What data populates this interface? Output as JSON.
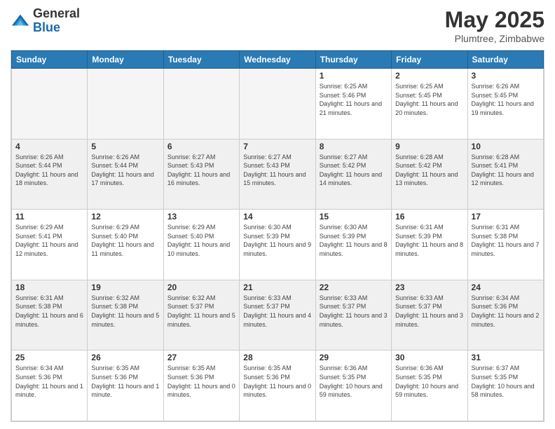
{
  "header": {
    "logo_general": "General",
    "logo_blue": "Blue",
    "title": "May 2025",
    "subtitle": "Plumtree, Zimbabwe"
  },
  "calendar": {
    "days_of_week": [
      "Sunday",
      "Monday",
      "Tuesday",
      "Wednesday",
      "Thursday",
      "Friday",
      "Saturday"
    ],
    "weeks": [
      [
        {
          "day": "",
          "empty": true
        },
        {
          "day": "",
          "empty": true
        },
        {
          "day": "",
          "empty": true
        },
        {
          "day": "",
          "empty": true
        },
        {
          "day": "1",
          "sunrise": "6:25 AM",
          "sunset": "5:46 PM",
          "daylight": "11 hours and 21 minutes."
        },
        {
          "day": "2",
          "sunrise": "6:25 AM",
          "sunset": "5:45 PM",
          "daylight": "11 hours and 20 minutes."
        },
        {
          "day": "3",
          "sunrise": "6:26 AM",
          "sunset": "5:45 PM",
          "daylight": "11 hours and 19 minutes."
        }
      ],
      [
        {
          "day": "4",
          "sunrise": "6:26 AM",
          "sunset": "5:44 PM",
          "daylight": "11 hours and 18 minutes."
        },
        {
          "day": "5",
          "sunrise": "6:26 AM",
          "sunset": "5:44 PM",
          "daylight": "11 hours and 17 minutes."
        },
        {
          "day": "6",
          "sunrise": "6:27 AM",
          "sunset": "5:43 PM",
          "daylight": "11 hours and 16 minutes."
        },
        {
          "day": "7",
          "sunrise": "6:27 AM",
          "sunset": "5:43 PM",
          "daylight": "11 hours and 15 minutes."
        },
        {
          "day": "8",
          "sunrise": "6:27 AM",
          "sunset": "5:42 PM",
          "daylight": "11 hours and 14 minutes."
        },
        {
          "day": "9",
          "sunrise": "6:28 AM",
          "sunset": "5:42 PM",
          "daylight": "11 hours and 13 minutes."
        },
        {
          "day": "10",
          "sunrise": "6:28 AM",
          "sunset": "5:41 PM",
          "daylight": "11 hours and 12 minutes."
        }
      ],
      [
        {
          "day": "11",
          "sunrise": "6:29 AM",
          "sunset": "5:41 PM",
          "daylight": "11 hours and 12 minutes."
        },
        {
          "day": "12",
          "sunrise": "6:29 AM",
          "sunset": "5:40 PM",
          "daylight": "11 hours and 11 minutes."
        },
        {
          "day": "13",
          "sunrise": "6:29 AM",
          "sunset": "5:40 PM",
          "daylight": "11 hours and 10 minutes."
        },
        {
          "day": "14",
          "sunrise": "6:30 AM",
          "sunset": "5:39 PM",
          "daylight": "11 hours and 9 minutes."
        },
        {
          "day": "15",
          "sunrise": "6:30 AM",
          "sunset": "5:39 PM",
          "daylight": "11 hours and 8 minutes."
        },
        {
          "day": "16",
          "sunrise": "6:31 AM",
          "sunset": "5:39 PM",
          "daylight": "11 hours and 8 minutes."
        },
        {
          "day": "17",
          "sunrise": "6:31 AM",
          "sunset": "5:38 PM",
          "daylight": "11 hours and 7 minutes."
        }
      ],
      [
        {
          "day": "18",
          "sunrise": "6:31 AM",
          "sunset": "5:38 PM",
          "daylight": "11 hours and 6 minutes."
        },
        {
          "day": "19",
          "sunrise": "6:32 AM",
          "sunset": "5:38 PM",
          "daylight": "11 hours and 5 minutes."
        },
        {
          "day": "20",
          "sunrise": "6:32 AM",
          "sunset": "5:37 PM",
          "daylight": "11 hours and 5 minutes."
        },
        {
          "day": "21",
          "sunrise": "6:33 AM",
          "sunset": "5:37 PM",
          "daylight": "11 hours and 4 minutes."
        },
        {
          "day": "22",
          "sunrise": "6:33 AM",
          "sunset": "5:37 PM",
          "daylight": "11 hours and 3 minutes."
        },
        {
          "day": "23",
          "sunrise": "6:33 AM",
          "sunset": "5:37 PM",
          "daylight": "11 hours and 3 minutes."
        },
        {
          "day": "24",
          "sunrise": "6:34 AM",
          "sunset": "5:36 PM",
          "daylight": "11 hours and 2 minutes."
        }
      ],
      [
        {
          "day": "25",
          "sunrise": "6:34 AM",
          "sunset": "5:36 PM",
          "daylight": "11 hours and 1 minute."
        },
        {
          "day": "26",
          "sunrise": "6:35 AM",
          "sunset": "5:36 PM",
          "daylight": "11 hours and 1 minute."
        },
        {
          "day": "27",
          "sunrise": "6:35 AM",
          "sunset": "5:36 PM",
          "daylight": "11 hours and 0 minutes."
        },
        {
          "day": "28",
          "sunrise": "6:35 AM",
          "sunset": "5:36 PM",
          "daylight": "11 hours and 0 minutes."
        },
        {
          "day": "29",
          "sunrise": "6:36 AM",
          "sunset": "5:35 PM",
          "daylight": "10 hours and 59 minutes."
        },
        {
          "day": "30",
          "sunrise": "6:36 AM",
          "sunset": "5:35 PM",
          "daylight": "10 hours and 59 minutes."
        },
        {
          "day": "31",
          "sunrise": "6:37 AM",
          "sunset": "5:35 PM",
          "daylight": "10 hours and 58 minutes."
        }
      ]
    ]
  }
}
